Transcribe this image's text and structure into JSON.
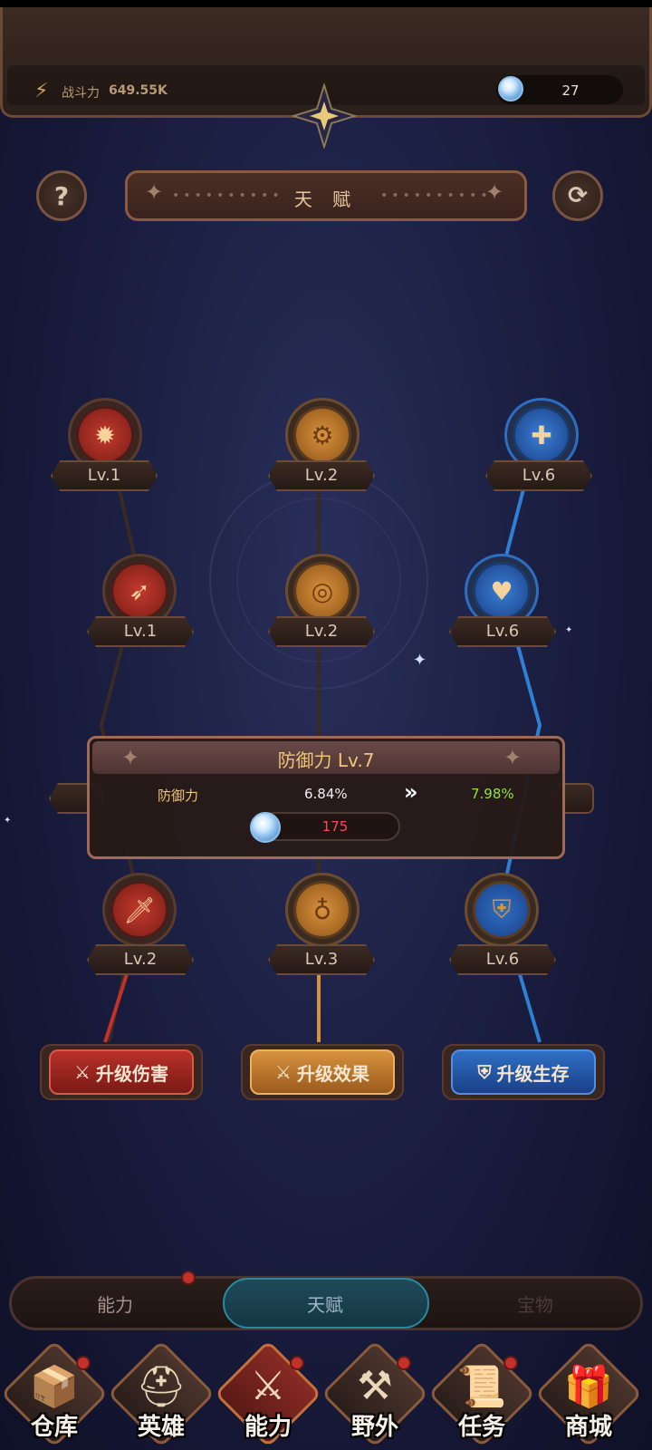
{
  "header": {
    "power_label": "战斗力",
    "power_value": "649.55K",
    "gem_count": "27"
  },
  "title_banner": {
    "title": "天 赋"
  },
  "buttons": {
    "help_symbol": "?",
    "refresh_symbol": "⟳"
  },
  "talent_tree": {
    "columns": [
      {
        "name": "damage",
        "color": "red",
        "nodes": [
          {
            "icon": "burst-icon",
            "glyph": "✹",
            "level": "Lv.1"
          },
          {
            "icon": "arrow-burst-icon",
            "glyph": "➶",
            "level": "Lv.1"
          },
          {
            "icon": "hidden-node",
            "glyph": "",
            "level": ""
          },
          {
            "icon": "sword-icon",
            "glyph": "🗡",
            "level": "Lv.2"
          }
        ]
      },
      {
        "name": "effect",
        "color": "gold",
        "nodes": [
          {
            "icon": "coin-bag-icon",
            "glyph": "⚙",
            "level": "Lv.2"
          },
          {
            "icon": "ring-icon",
            "glyph": "◎",
            "level": "Lv.2"
          },
          {
            "icon": "hidden-node",
            "glyph": "",
            "level": ""
          },
          {
            "icon": "money-bag-icon",
            "glyph": "♁",
            "level": "Lv.3"
          }
        ]
      },
      {
        "name": "survival",
        "color": "blue",
        "nodes": [
          {
            "icon": "heal-plus-icon",
            "glyph": "✚",
            "level": "Lv.6"
          },
          {
            "icon": "heart-icon",
            "glyph": "♥",
            "level": "Lv.6"
          },
          {
            "icon": "hidden-node",
            "glyph": "",
            "level": ""
          },
          {
            "icon": "shield-icon",
            "glyph": "⛨",
            "level": "Lv.6"
          }
        ]
      }
    ]
  },
  "popup": {
    "title": "防御力 Lv.7",
    "stat_name": "防御力",
    "current_value": "6.84%",
    "arrow": "»",
    "next_value": "7.98%",
    "cost": "175"
  },
  "upgrade_buttons": {
    "damage": "升级伤害",
    "effect": "升级效果",
    "survival": "升级生存"
  },
  "segment_tabs": {
    "ability": "能力",
    "talent": "天赋",
    "treasure": "宝物",
    "selected": "talent"
  },
  "bottom_nav": [
    {
      "label": "仓库",
      "icon": "warehouse-icon",
      "glyph": "📦",
      "dot": true
    },
    {
      "label": "英雄",
      "icon": "helmet-icon",
      "glyph": "⛑",
      "dot": false
    },
    {
      "label": "能力",
      "icon": "crossed-swords-icon",
      "glyph": "⚔",
      "dot": true,
      "active": true
    },
    {
      "label": "野外",
      "icon": "hammer-icon",
      "glyph": "⚒",
      "dot": true
    },
    {
      "label": "任务",
      "icon": "scroll-icon",
      "glyph": "📜",
      "dot": true
    },
    {
      "label": "商城",
      "icon": "treasure-chest-icon",
      "glyph": "🎁",
      "dot": false
    }
  ],
  "colors": {
    "red_branch": "#c4302a",
    "gold_branch": "#d8923e",
    "blue_branch": "#2f7fd4",
    "next_value": "#8fe34a",
    "cost_insufficient": "#ff4a5a"
  }
}
